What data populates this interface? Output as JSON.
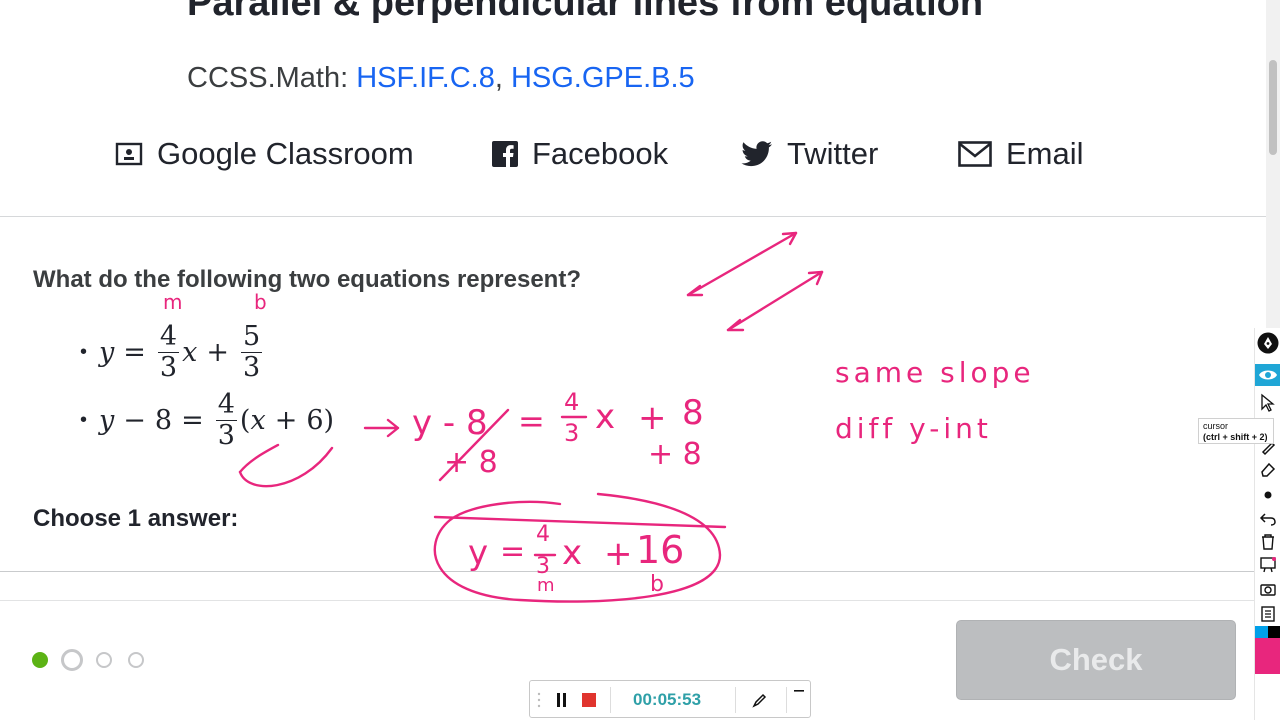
{
  "page": {
    "title": "Parallel & perpendicular lines from equation",
    "ccss_prefix": "CCSS.Math:",
    "standards": [
      "HSF.IF.C.8",
      "HSG.GPE.B.5"
    ],
    "standards_sep": ", "
  },
  "share": {
    "google_classroom": "Google Classroom",
    "facebook": "Facebook",
    "twitter": "Twitter",
    "email": "Email"
  },
  "question": {
    "prompt": "What do the following two equations represent?",
    "eq1": {
      "lhs": "y",
      "eq": "=",
      "m_num": "4",
      "m_den": "3",
      "var": "x",
      "plus": "+",
      "b_num": "5",
      "b_den": "3"
    },
    "eq2": {
      "lhs_var": "y",
      "minus": "−",
      "lhs_const": "8",
      "eq": "=",
      "m_num": "4",
      "m_den": "3",
      "paren_open": "(",
      "var": "x",
      "plus": "+",
      "const": "6",
      "paren_close": ")"
    },
    "choose_label": "Choose 1 answer:"
  },
  "footer": {
    "progress_dots": [
      {
        "state": "complete",
        "color": "#5cb315"
      },
      {
        "state": "current",
        "color": "#c6c7c9"
      },
      {
        "state": "upcoming",
        "color": "#c6c7c9"
      },
      {
        "state": "upcoming",
        "color": "#c6c7c9"
      }
    ],
    "check_label": "Check"
  },
  "handwriting": {
    "m_label": "m",
    "b_label": "b",
    "step1_left": "y - 8",
    "step1_eq": "=",
    "step1_frac_num": "4",
    "step1_frac_den": "3",
    "step1_x": "x",
    "step1_plus": "+",
    "step1_const": "8",
    "step2_left": "+ 8",
    "step2_right": "+ 8",
    "result_y": "y",
    "result_eq": "=",
    "result_num": "4",
    "result_den": "3",
    "result_x": "x",
    "result_plus": "+",
    "result_const": "16",
    "result_m": "m",
    "result_b": "b",
    "note_line1": "same slope",
    "note_line2": "diff y-int",
    "ink_color": "#e8267d"
  },
  "annotation_toolbar": {
    "tooltip_title": "cursor",
    "tooltip_shortcut": "(ctrl + shift + 2)",
    "tools": [
      "pen-icon",
      "eye-icon",
      "cursor-icon",
      "highlighter-icon",
      "eraser-icon",
      "dot-icon",
      "undo-icon",
      "trash-icon",
      "whiteboard-icon",
      "camera-icon",
      "clipboard-icon",
      "palette-icon"
    ],
    "palette_colors": [
      "#00a0e9",
      "#000000",
      "#e8267d",
      "#ffe100"
    ]
  },
  "recorder": {
    "time": "00:05:53"
  }
}
